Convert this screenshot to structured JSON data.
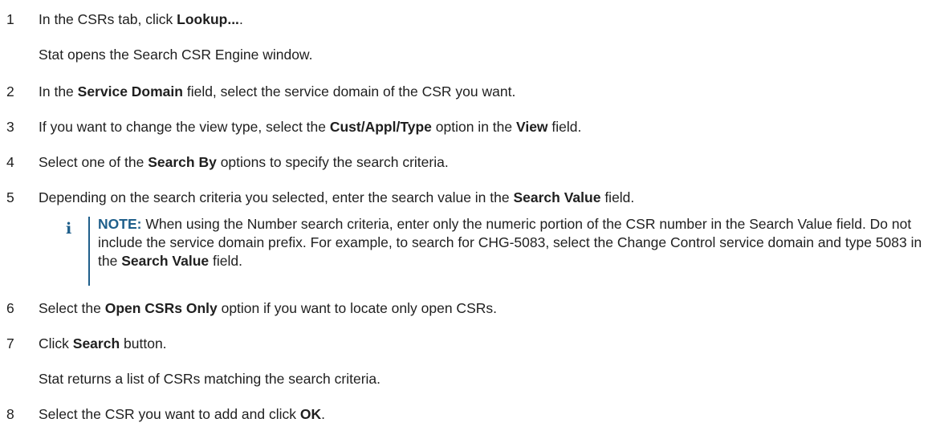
{
  "steps": [
    {
      "n": "1",
      "parts": [
        "In the CSRs tab, click ",
        "Lookup...",
        "."
      ]
    },
    {
      "sub": "Stat opens the Search CSR Engine window."
    },
    {
      "n": "2",
      "parts": [
        "In the ",
        "Service Domain",
        " field, select the service domain of the CSR you want."
      ]
    },
    {
      "n": "3",
      "parts": [
        "If you want to change the view type, select the ",
        "Cust/Appl/Type",
        " option in the ",
        "View",
        " field."
      ]
    },
    {
      "n": "4",
      "parts": [
        "Select one of the ",
        "Search By",
        " options to specify the search criteria."
      ]
    },
    {
      "n": "5",
      "parts": [
        "Depending on the search criteria you selected, enter the search value in the ",
        "Search Value",
        " field."
      ]
    },
    {
      "n": "6",
      "parts": [
        "Select the ",
        "Open CSRs Only",
        " option if you want to locate only open CSRs."
      ]
    },
    {
      "n": "7",
      "parts": [
        "Click ",
        "Search",
        " button."
      ]
    },
    {
      "sub2": "Stat returns a list of CSRs matching the search criteria."
    },
    {
      "n": "8",
      "parts": [
        "Select the CSR you want to add and click ",
        "OK",
        "."
      ]
    }
  ],
  "note": {
    "icon": "i",
    "label": "NOTE:",
    "text1": " When using the Number search criteria, enter only the numeric portion of the CSR number in the Search Value field. Do not include the service domain prefix. For example, to search for CHG-5083, select the Change Control service domain and type 5083 in the ",
    "bold": "Search Value",
    "text2": " field."
  }
}
